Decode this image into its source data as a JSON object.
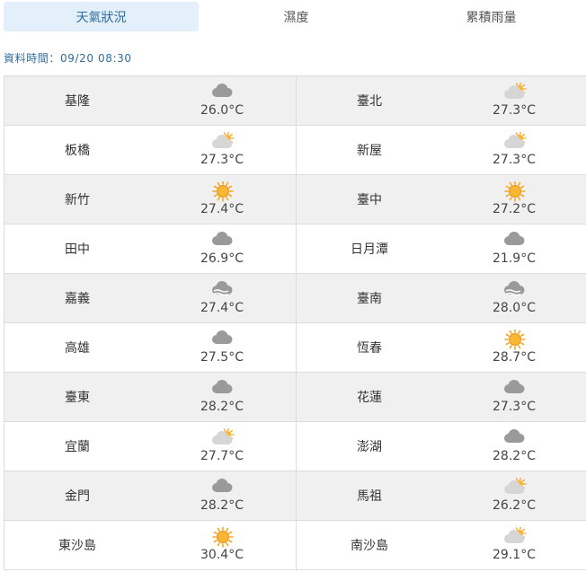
{
  "tabs": [
    {
      "label": "天氣狀況",
      "active": true
    },
    {
      "label": "濕度",
      "active": false
    },
    {
      "label": "累積雨量",
      "active": false
    }
  ],
  "timestamp": "資料時間：09/20 08:30",
  "colors": {
    "accent": "#2f6d9c",
    "active_tab_bg": "#e3f0fb",
    "sun": "#f5a623",
    "cloud": "#9a9a9a"
  },
  "stations": [
    [
      {
        "name": "基隆",
        "temp": "26.0°C",
        "icon": "cloudy-icon"
      },
      {
        "name": "臺北",
        "temp": "27.3°C",
        "icon": "partly-cloudy-icon"
      }
    ],
    [
      {
        "name": "板橋",
        "temp": "27.3°C",
        "icon": "partly-cloudy-icon"
      },
      {
        "name": "新屋",
        "temp": "27.3°C",
        "icon": "partly-cloudy-icon"
      }
    ],
    [
      {
        "name": "新竹",
        "temp": "27.4°C",
        "icon": "sunny-icon"
      },
      {
        "name": "臺中",
        "temp": "27.2°C",
        "icon": "sunny-icon"
      }
    ],
    [
      {
        "name": "田中",
        "temp": "26.9°C",
        "icon": "cloudy-icon"
      },
      {
        "name": "日月潭",
        "temp": "21.9°C",
        "icon": "cloudy-icon"
      }
    ],
    [
      {
        "name": "嘉義",
        "temp": "27.4°C",
        "icon": "haze-icon"
      },
      {
        "name": "臺南",
        "temp": "28.0°C",
        "icon": "haze-icon"
      }
    ],
    [
      {
        "name": "高雄",
        "temp": "27.5°C",
        "icon": "cloudy-icon"
      },
      {
        "name": "恆春",
        "temp": "28.7°C",
        "icon": "sunny-icon"
      }
    ],
    [
      {
        "name": "臺東",
        "temp": "28.2°C",
        "icon": "cloudy-icon"
      },
      {
        "name": "花蓮",
        "temp": "27.3°C",
        "icon": "cloudy-icon"
      }
    ],
    [
      {
        "name": "宜蘭",
        "temp": "27.7°C",
        "icon": "partly-cloudy-icon"
      },
      {
        "name": "澎湖",
        "temp": "28.2°C",
        "icon": "cloudy-icon"
      }
    ],
    [
      {
        "name": "金門",
        "temp": "28.2°C",
        "icon": "cloudy-icon"
      },
      {
        "name": "馬祖",
        "temp": "26.2°C",
        "icon": "partly-cloudy-icon"
      }
    ],
    [
      {
        "name": "東沙島",
        "temp": "30.4°C",
        "icon": "sunny-icon"
      },
      {
        "name": "南沙島",
        "temp": "29.1°C",
        "icon": "partly-cloudy-icon"
      }
    ]
  ]
}
